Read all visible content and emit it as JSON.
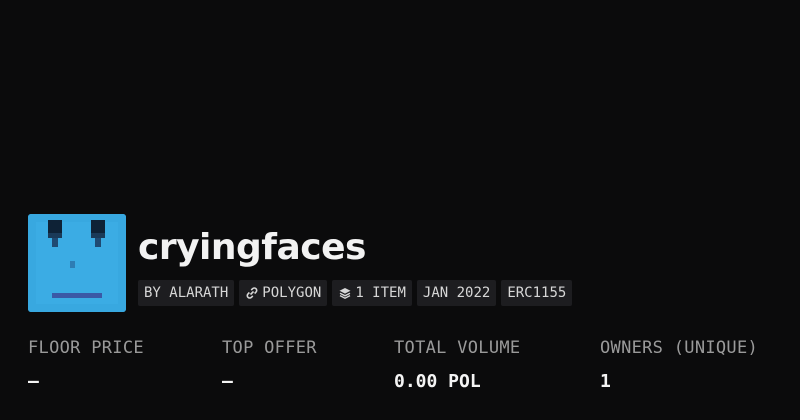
{
  "collection": {
    "name": "cryingfaces",
    "badges": {
      "creator": "BY ALARATH",
      "chain": "POLYGON",
      "items": "1 ITEM",
      "date": "JAN 2022",
      "standard": "ERC1155"
    },
    "icons": {
      "chain": "link-icon",
      "items": "stack-icon"
    }
  },
  "stats": {
    "floor_price": {
      "label": "FLOOR PRICE",
      "value": "—"
    },
    "top_offer": {
      "label": "TOP OFFER",
      "value": "—"
    },
    "total_volume": {
      "label": "TOTAL VOLUME",
      "value": "0.00 POL"
    },
    "owners": {
      "label": "OWNERS (UNIQUE)",
      "value": "1"
    }
  },
  "colors": {
    "background": "#0b0b0c",
    "avatar": "#38a8e0",
    "badge": "#1d1d20"
  }
}
